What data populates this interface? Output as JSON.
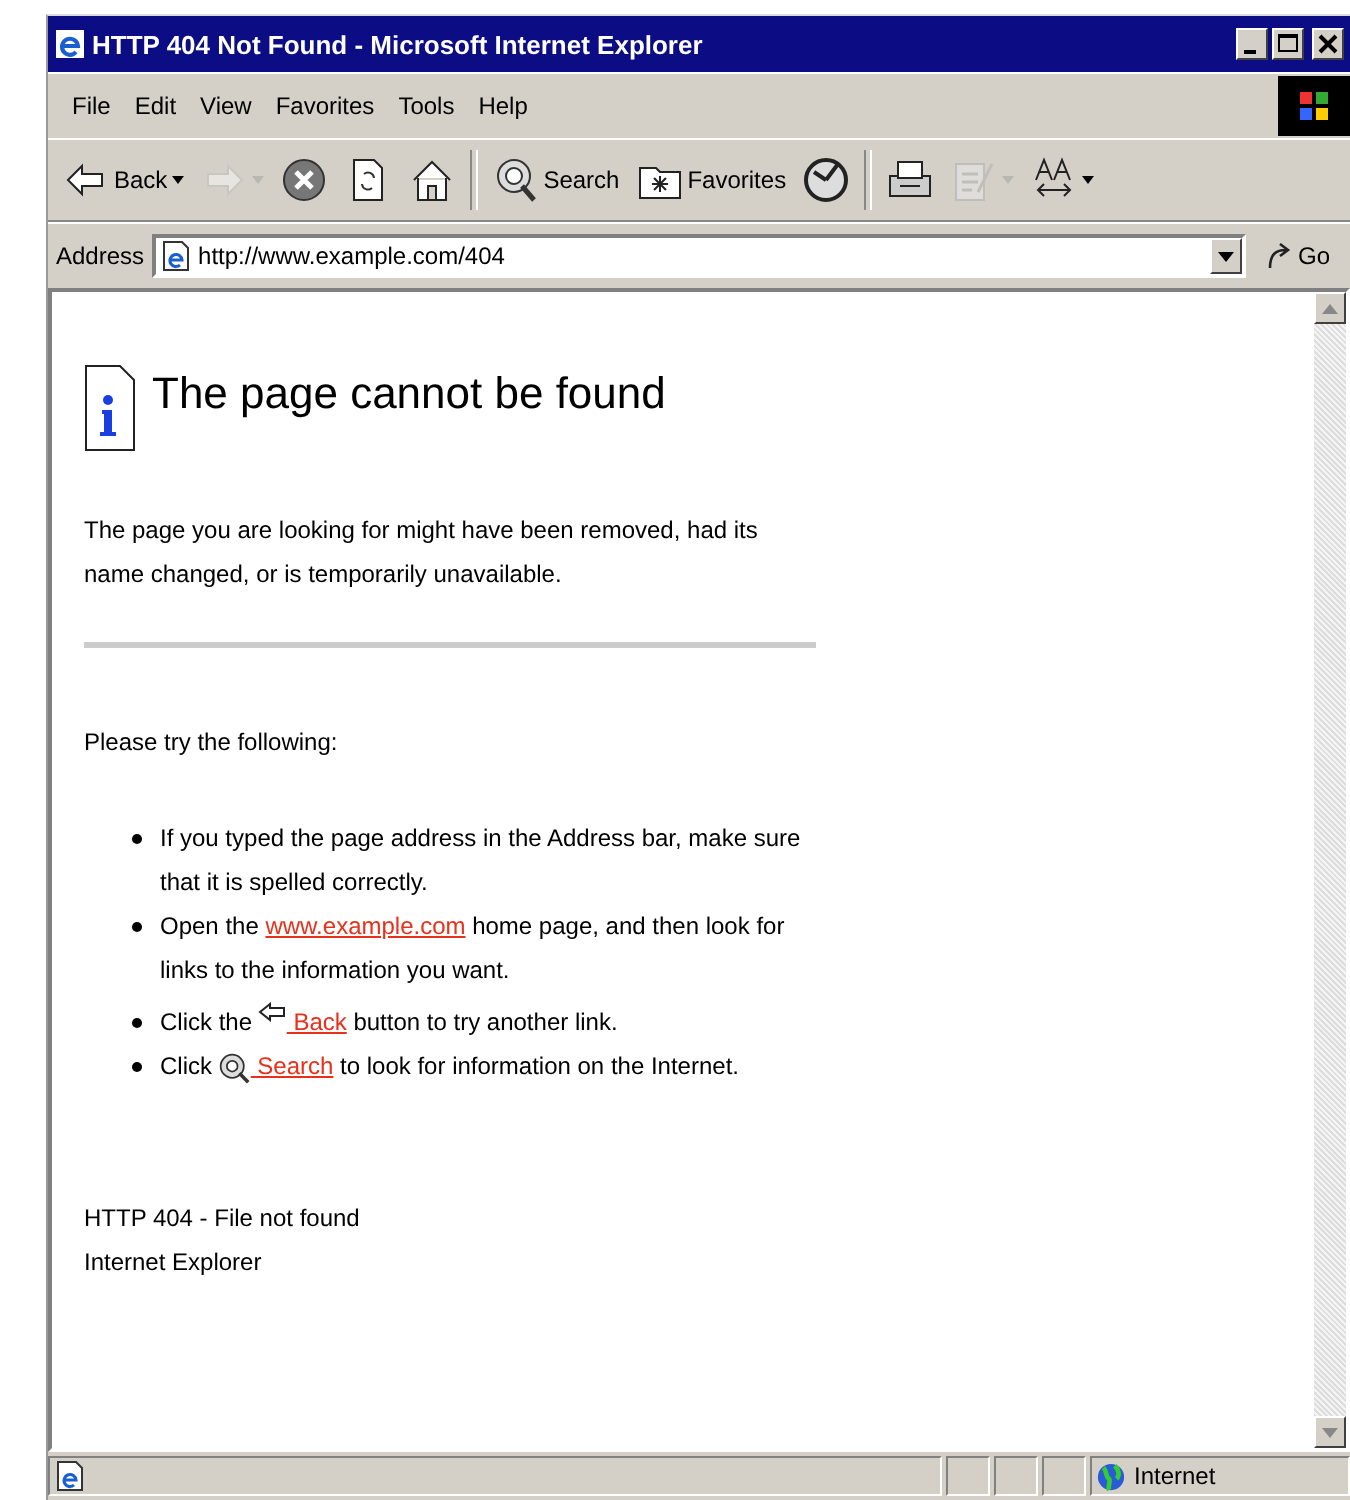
{
  "window": {
    "title": "HTTP 404 Not Found - Microsoft Internet Explorer"
  },
  "menu": [
    "File",
    "Edit",
    "View",
    "Favorites",
    "Tools",
    "Help"
  ],
  "toolbar": [
    {
      "kind": "back",
      "label": "Back",
      "dropdown": true,
      "disabled": false
    },
    {
      "kind": "forward",
      "dropdown": true,
      "disabled": true
    },
    {
      "kind": "stop",
      "dropdown": false,
      "disabled": false
    },
    {
      "kind": "refresh",
      "dropdown": false,
      "disabled": false
    },
    {
      "kind": "home",
      "dropdown": false,
      "disabled": false
    },
    {
      "kind": "search",
      "label": "Search",
      "dropdown": false,
      "disabled": false
    },
    {
      "kind": "favorites",
      "label": "Favorites",
      "dropdown": false,
      "disabled": false
    },
    {
      "kind": "history",
      "dropdown": false,
      "disabled": false
    },
    {
      "kind": "print",
      "dropdown": false,
      "disabled": false
    },
    {
      "kind": "edit",
      "dropdown": true,
      "disabled": true
    },
    {
      "kind": "encoding",
      "dropdown": true,
      "disabled": false
    }
  ],
  "address": {
    "label": "Address",
    "value": "http://www.example.com/404",
    "go": "Go"
  },
  "page": {
    "heading": "The page cannot be found",
    "intro": "The page you are looking for might have been removed, had its name changed, or is temporarily unavailable.",
    "try": "Please try the following:",
    "items": [
      [
        {
          "kind": "text",
          "text": "If you typed the page address in the Address bar, make sure that it is spelled correctly."
        }
      ],
      [
        {
          "kind": "text",
          "text": "Open the "
        },
        {
          "kind": "link",
          "text": "www.example.com"
        },
        {
          "kind": "text",
          "text": " home page, and then look for links to the information you want."
        }
      ],
      [
        {
          "kind": "text",
          "text": "Click the "
        },
        {
          "kind": "back-icon"
        },
        {
          "kind": "link",
          "text": " Back"
        },
        {
          "kind": "text",
          "text": " button to try another link."
        }
      ],
      [
        {
          "kind": "text",
          "text": "Click "
        },
        {
          "kind": "search-icon"
        },
        {
          "kind": "link",
          "text": " Search"
        },
        {
          "kind": "text",
          "text": " to look for information on the Internet."
        }
      ]
    ],
    "footer": [
      "HTTP 404 - File not found",
      "Internet Explorer"
    ]
  },
  "status_bar": {
    "zone": "Internet"
  }
}
